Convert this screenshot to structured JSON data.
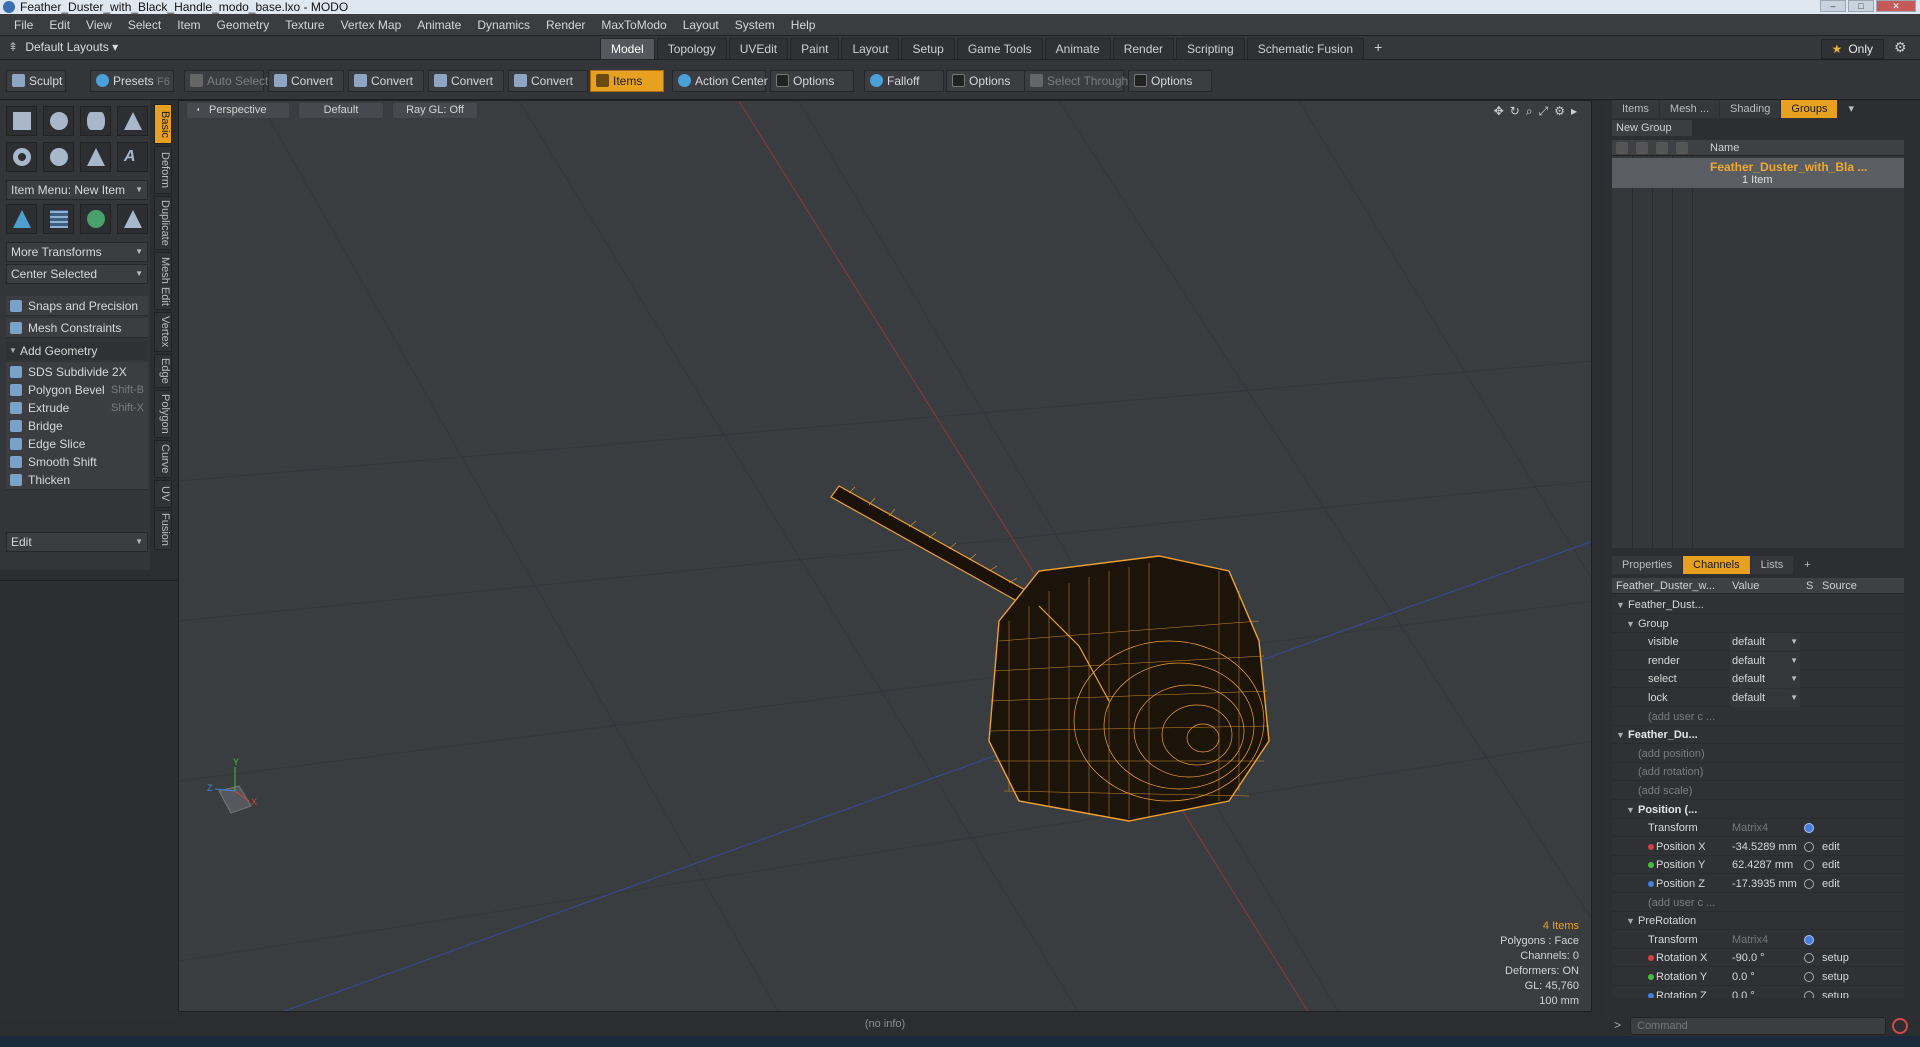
{
  "window": {
    "title": "Feather_Duster_with_Black_Handle_modo_base.lxo - MODO"
  },
  "menu": [
    "File",
    "Edit",
    "View",
    "Select",
    "Item",
    "Geometry",
    "Texture",
    "Vertex Map",
    "Animate",
    "Dynamics",
    "Render",
    "MaxToModo",
    "Layout",
    "System",
    "Help"
  ],
  "layoutbar": {
    "layouts_label": "Default Layouts",
    "tabs": [
      "Model",
      "Topology",
      "UVEdit",
      "Paint",
      "Layout",
      "Setup",
      "Game Tools",
      "Animate",
      "Render",
      "Scripting",
      "Schematic Fusion"
    ],
    "active_tab": "Model",
    "only_label": "Only"
  },
  "toolbar": {
    "sculpt": "Sculpt",
    "presets": "Presets",
    "presets_shortcut": "F6",
    "auto_select": "Auto Select",
    "convert1": "Convert",
    "convert2": "Convert",
    "convert3": "Convert",
    "convert4": "Convert",
    "items": "Items",
    "action_center": "Action Center",
    "options1": "Options",
    "falloff": "Falloff",
    "options2": "Options",
    "select_through": "Select Through",
    "options3": "Options"
  },
  "leftpanel": {
    "item_menu": "Item Menu: New Item",
    "more_transforms": "More Transforms",
    "center_selected": "Center Selected",
    "snaps": "Snaps and Precision",
    "mesh_constraints": "Mesh Constraints",
    "add_geometry": "Add Geometry",
    "tools": [
      {
        "label": "SDS Subdivide 2X",
        "shortcut": ""
      },
      {
        "label": "Polygon Bevel",
        "shortcut": "Shift-B"
      },
      {
        "label": "Extrude",
        "shortcut": "Shift-X"
      },
      {
        "label": "Bridge",
        "shortcut": ""
      },
      {
        "label": "Edge Slice",
        "shortcut": ""
      },
      {
        "label": "Smooth Shift",
        "shortcut": ""
      },
      {
        "label": "Thicken",
        "shortcut": ""
      }
    ],
    "edit": "Edit",
    "vtabs": [
      "Basic",
      "Deform",
      "Duplicate",
      "Mesh Edit",
      "Vertex",
      "Edge",
      "Polygon",
      "Curve",
      "UV",
      "Fusion"
    ]
  },
  "viewport": {
    "view": "Perspective",
    "shading": "Default",
    "raygl": "Ray GL: Off",
    "stats": {
      "items": "4 Items",
      "polygons": "Polygons : Face",
      "channels": "Channels: 0",
      "deformers": "Deformers: ON",
      "gl": "GL: 45,760",
      "scale": "100 mm"
    },
    "status": "(no info)",
    "accent": "#f0a030"
  },
  "groups_panel": {
    "tabs": [
      "Items",
      "Mesh ...",
      "Shading",
      "Groups"
    ],
    "active_tab": "Groups",
    "new_group": "New Group",
    "name_header": "Name",
    "group_name": "Feather_Duster_with_Bla ...",
    "group_count": "1 Item"
  },
  "channels_panel": {
    "tabs": [
      "Properties",
      "Channels",
      "Lists"
    ],
    "active_tab": "Channels",
    "header": {
      "name": "Feather_Duster_w...",
      "value": "Value",
      "s": "S",
      "source": "Source"
    },
    "rows": [
      {
        "name": "Feather_Dust...",
        "indent": 1,
        "kind": "tree"
      },
      {
        "name": "Group",
        "indent": 2,
        "kind": "tree"
      },
      {
        "name": "visible",
        "value": "default",
        "indent": 3,
        "kind": "dd"
      },
      {
        "name": "render",
        "value": "default",
        "indent": 3,
        "kind": "dd"
      },
      {
        "name": "select",
        "value": "default",
        "indent": 3,
        "kind": "dd"
      },
      {
        "name": "lock",
        "value": "default",
        "indent": 3,
        "kind": "dd"
      },
      {
        "name": "(add user c ...",
        "indent": 3,
        "kind": "dim"
      },
      {
        "name": "Feather_Du...",
        "indent": 1,
        "kind": "bold"
      },
      {
        "name": "(add position)",
        "indent": 2,
        "kind": "dim"
      },
      {
        "name": "(add rotation)",
        "indent": 2,
        "kind": "dim"
      },
      {
        "name": "(add scale)",
        "indent": 2,
        "kind": "dim"
      },
      {
        "name": "Position (...",
        "indent": 2,
        "kind": "bold"
      },
      {
        "name": "Transform",
        "value": "Matrix4",
        "indent": 3,
        "kind": "matrix"
      },
      {
        "name": "Position X",
        "value": "-34.5289 mm",
        "source": "edit",
        "indent": 3,
        "kind": "x"
      },
      {
        "name": "Position Y",
        "value": "62.4287 mm",
        "source": "edit",
        "indent": 3,
        "kind": "y"
      },
      {
        "name": "Position Z",
        "value": "-17.3935 mm",
        "source": "edit",
        "indent": 3,
        "kind": "z"
      },
      {
        "name": "(add user c ...",
        "indent": 3,
        "kind": "dim"
      },
      {
        "name": "PreRotation",
        "indent": 2,
        "kind": "tree"
      },
      {
        "name": "Transform",
        "value": "Matrix4",
        "indent": 3,
        "kind": "matrix"
      },
      {
        "name": "Rotation X",
        "value": "-90.0 °",
        "source": "setup",
        "indent": 3,
        "kind": "x"
      },
      {
        "name": "Rotation Y",
        "value": "0.0 °",
        "source": "setup",
        "indent": 3,
        "kind": "y"
      },
      {
        "name": "Rotation Z",
        "value": "0.0 °",
        "source": "setup",
        "indent": 3,
        "kind": "z"
      }
    ]
  },
  "command": {
    "placeholder": "Command",
    "prompt": ">"
  },
  "colors": {
    "accent": "#e8a020",
    "axis_x": "#d84040",
    "axis_y": "#40c040",
    "axis_z": "#4080e0"
  }
}
